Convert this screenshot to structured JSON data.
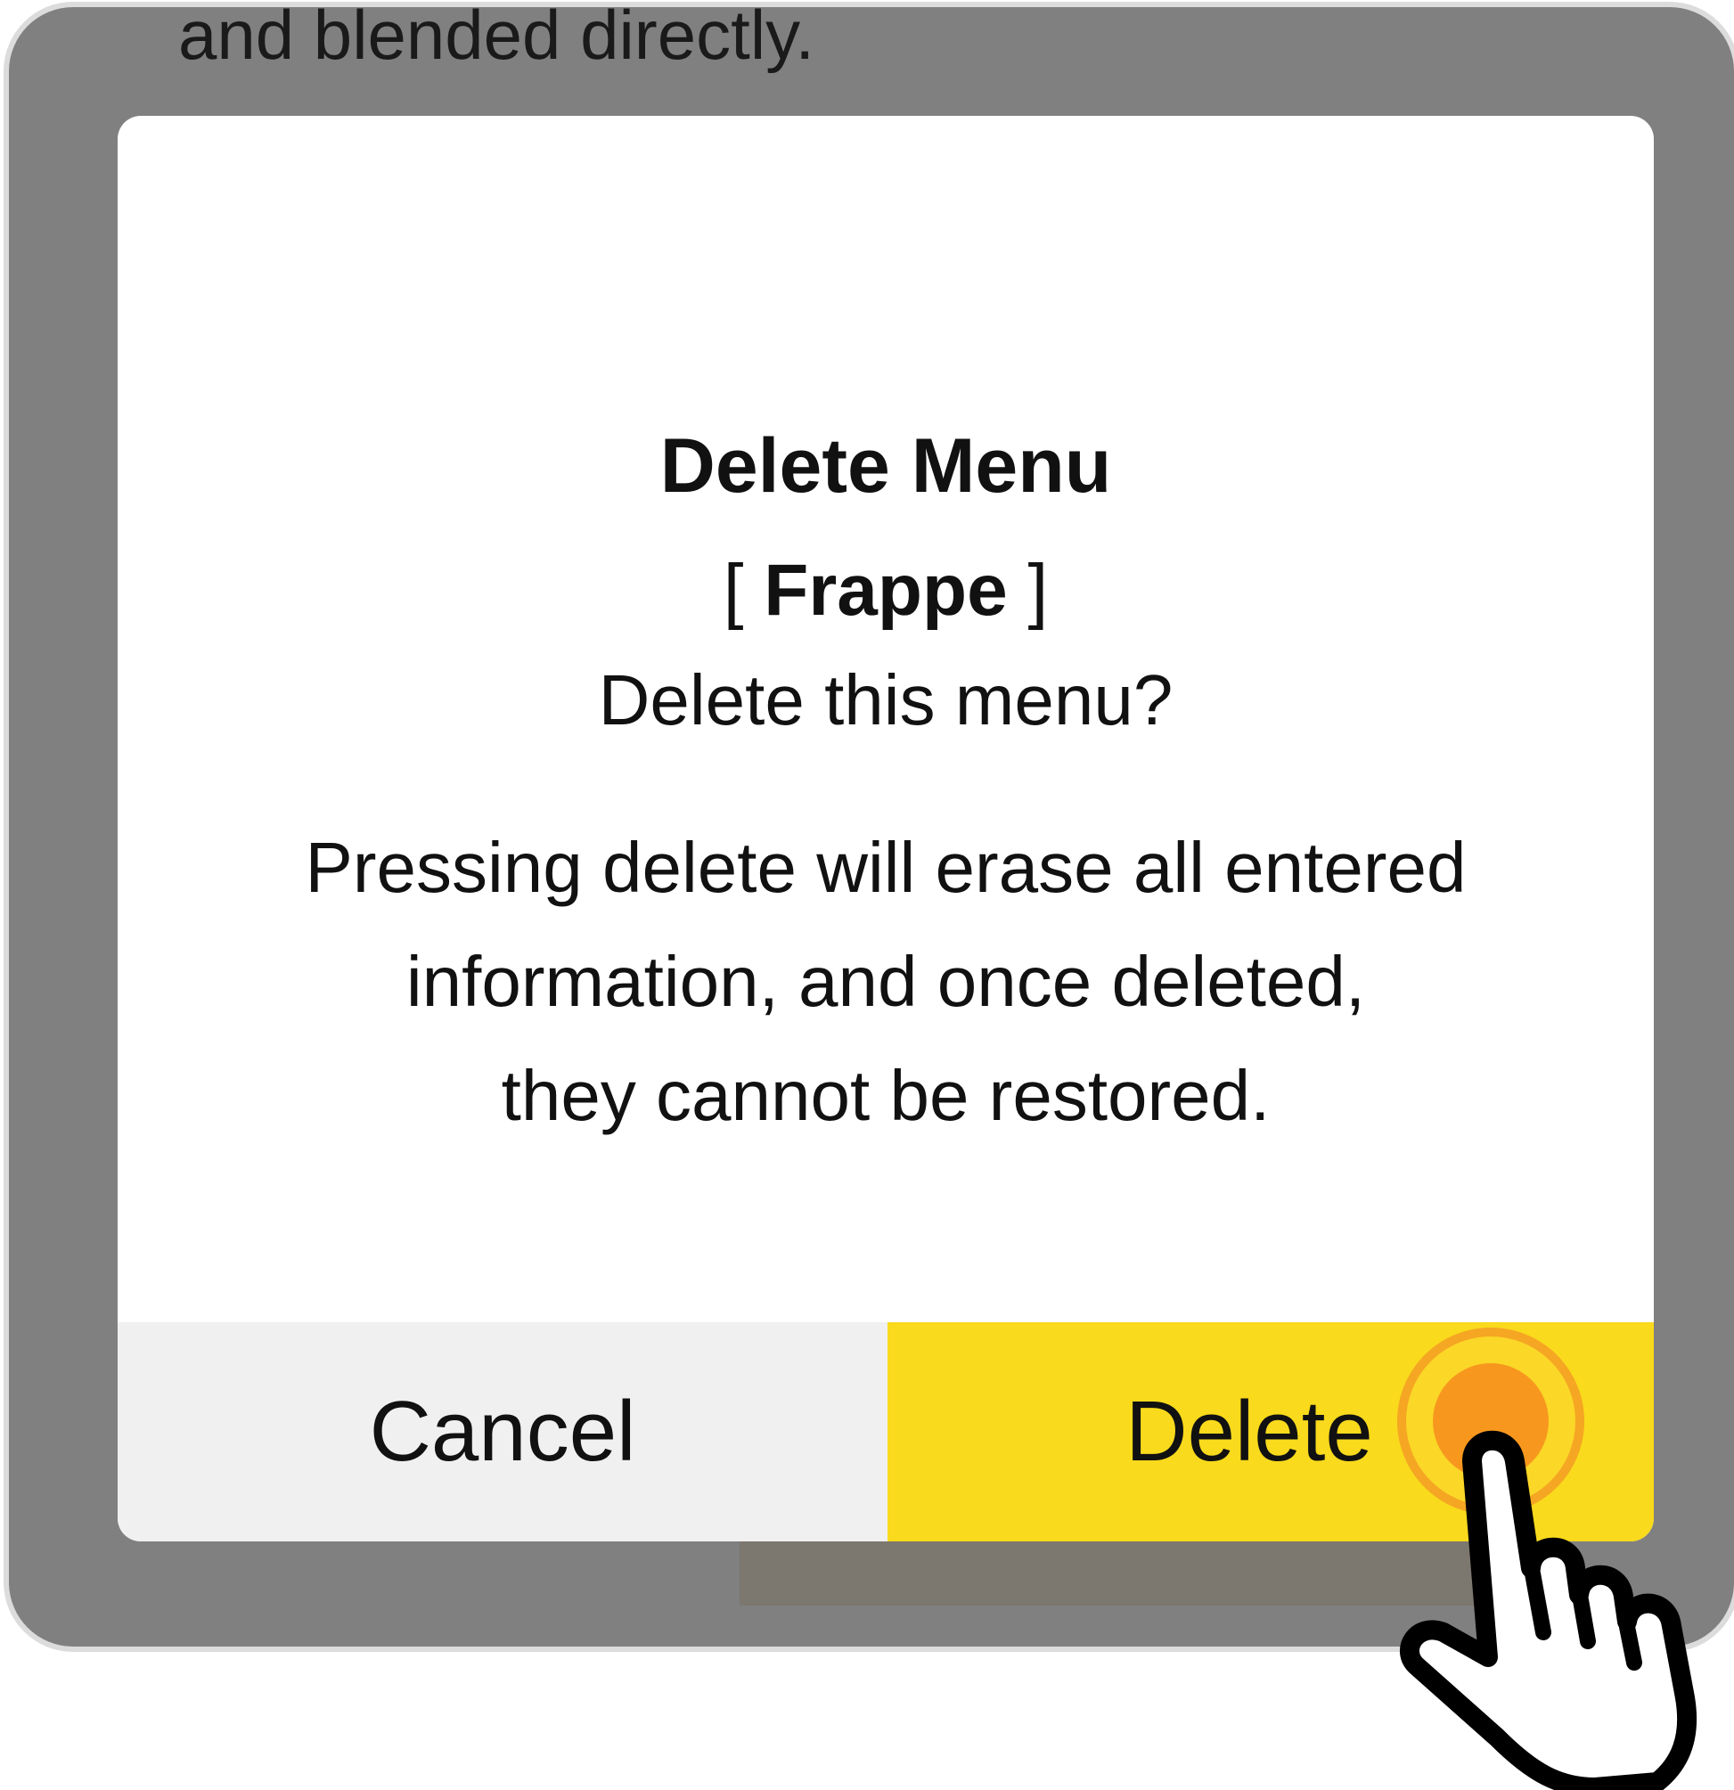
{
  "background": {
    "partial_text": "and blended directly."
  },
  "dialog": {
    "title": "Delete Menu",
    "item_name": "Frappe",
    "bracket_open": "[ ",
    "bracket_close": " ]",
    "question": "Delete this menu?",
    "warning_lines": [
      "Pressing delete will erase all entered",
      "information, and once deleted,",
      "they cannot be restored."
    ],
    "cancel_label": "Cancel",
    "delete_label": "Delete"
  },
  "colors": {
    "frame": "#808080",
    "delete_button": "#f9da1c",
    "cancel_button": "#f0f0f0",
    "touch_indicator": "#f7941d"
  },
  "icons": {
    "pointer": "pointing-hand-icon",
    "touch": "tap-ripple-icon"
  }
}
